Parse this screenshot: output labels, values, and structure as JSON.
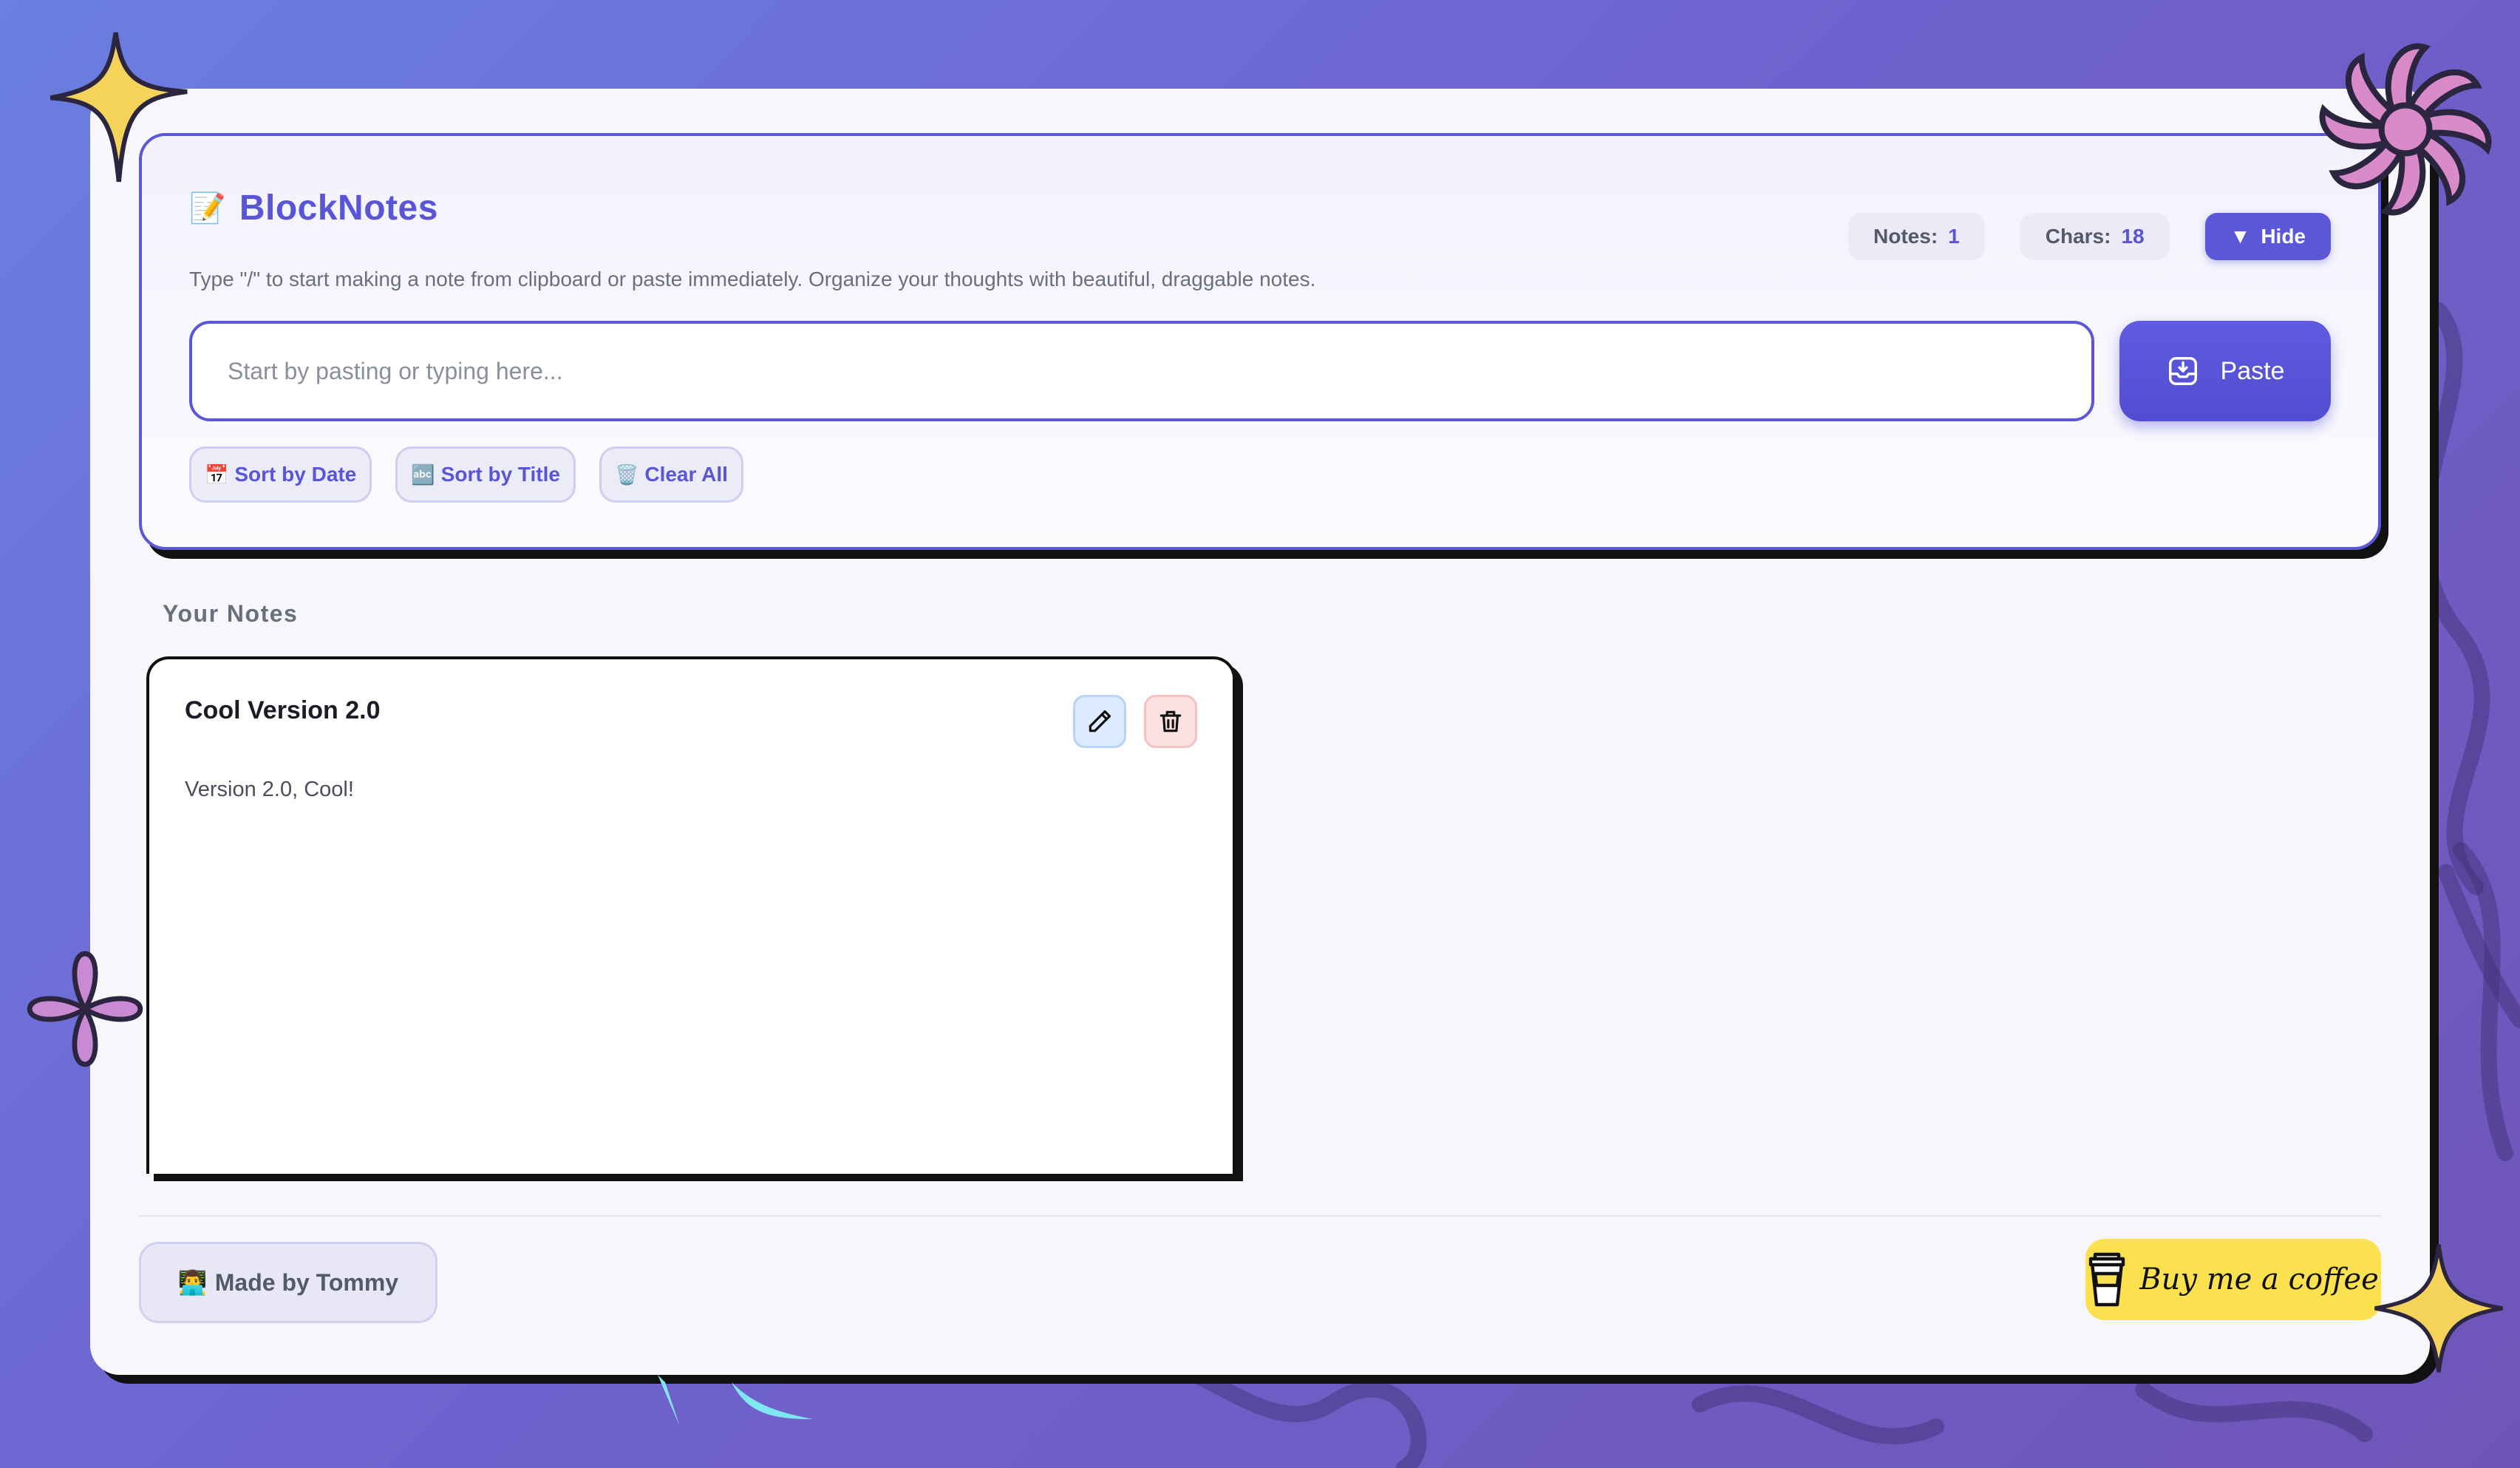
{
  "app": {
    "icon": "memo-icon",
    "title": "BlockNotes",
    "subtitle": "Type \"/\" to start making a note from clipboard or paste immediately. Organize your thoughts with beautiful, draggable notes."
  },
  "stats": {
    "notes_label": "Notes:",
    "notes_value": "1",
    "chars_label": "Chars:",
    "chars_value": "18",
    "hide_icon": "▼",
    "hide_label": "Hide"
  },
  "composer": {
    "placeholder": "Start by pasting or typing here...",
    "value": "",
    "paste_label": "Paste",
    "paste_icon": "inbox-download-icon"
  },
  "actions": [
    {
      "icon": "📅",
      "label": "Sort by Date"
    },
    {
      "icon": "🔤",
      "label": "Sort by Title"
    },
    {
      "icon": "🗑️",
      "label": "Clear All"
    }
  ],
  "notes_section": {
    "label": "Your Notes",
    "notes": [
      {
        "title": "Cool Version 2.0",
        "body": "Version 2.0, Cool!",
        "edit_icon": "pencil-icon",
        "delete_icon": "trash-icon"
      }
    ]
  },
  "footer": {
    "made_by_icon": "👨‍💻",
    "made_by_label": "Made by Tommy",
    "coffee_label": "Buy me a coffee",
    "coffee_icon": "coffee-cup-icon"
  },
  "colors": {
    "accent": "#5b57d8",
    "background_start": "#6a7fe0",
    "background_end": "#6f55b8",
    "coffee_yellow": "#fbe14f",
    "star_yellow": "#f5d35a",
    "flower_pink": "#d98ac8"
  }
}
